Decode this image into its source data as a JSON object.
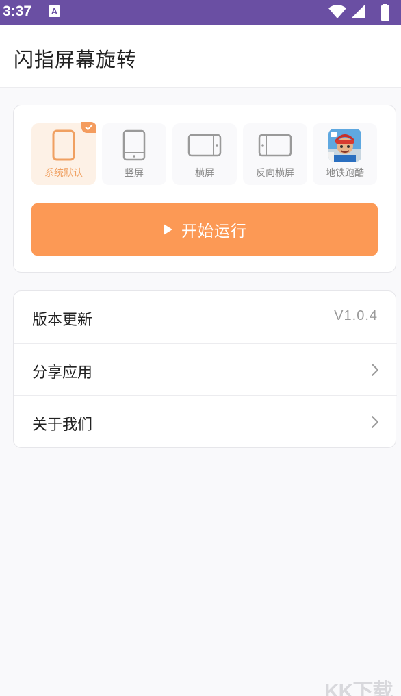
{
  "status_bar": {
    "time": "3:37",
    "notification_letter": "A"
  },
  "app": {
    "title": "闪指屏幕旋转"
  },
  "modes": [
    {
      "label": "系统默认",
      "icon": "phone-portrait-icon",
      "selected": true
    },
    {
      "label": "竖屏",
      "icon": "tablet-portrait-icon",
      "selected": false
    },
    {
      "label": "横屏",
      "icon": "tablet-landscape-icon",
      "selected": false
    },
    {
      "label": "反向横屏",
      "icon": "tablet-landscape-reverse-icon",
      "selected": false
    },
    {
      "label": "地铁跑酷",
      "icon": "subway-surfers-app-icon",
      "selected": false
    }
  ],
  "run_button": {
    "label": "开始运行"
  },
  "settings": {
    "version": {
      "label": "版本更新",
      "value": "V1.0.4"
    },
    "share": {
      "label": "分享应用"
    },
    "about": {
      "label": "关于我们"
    }
  },
  "watermark": "KK下载",
  "colors": {
    "accent": "#fc9955",
    "status_bar": "#6a4fa3",
    "selected_label": "#f0a061"
  }
}
